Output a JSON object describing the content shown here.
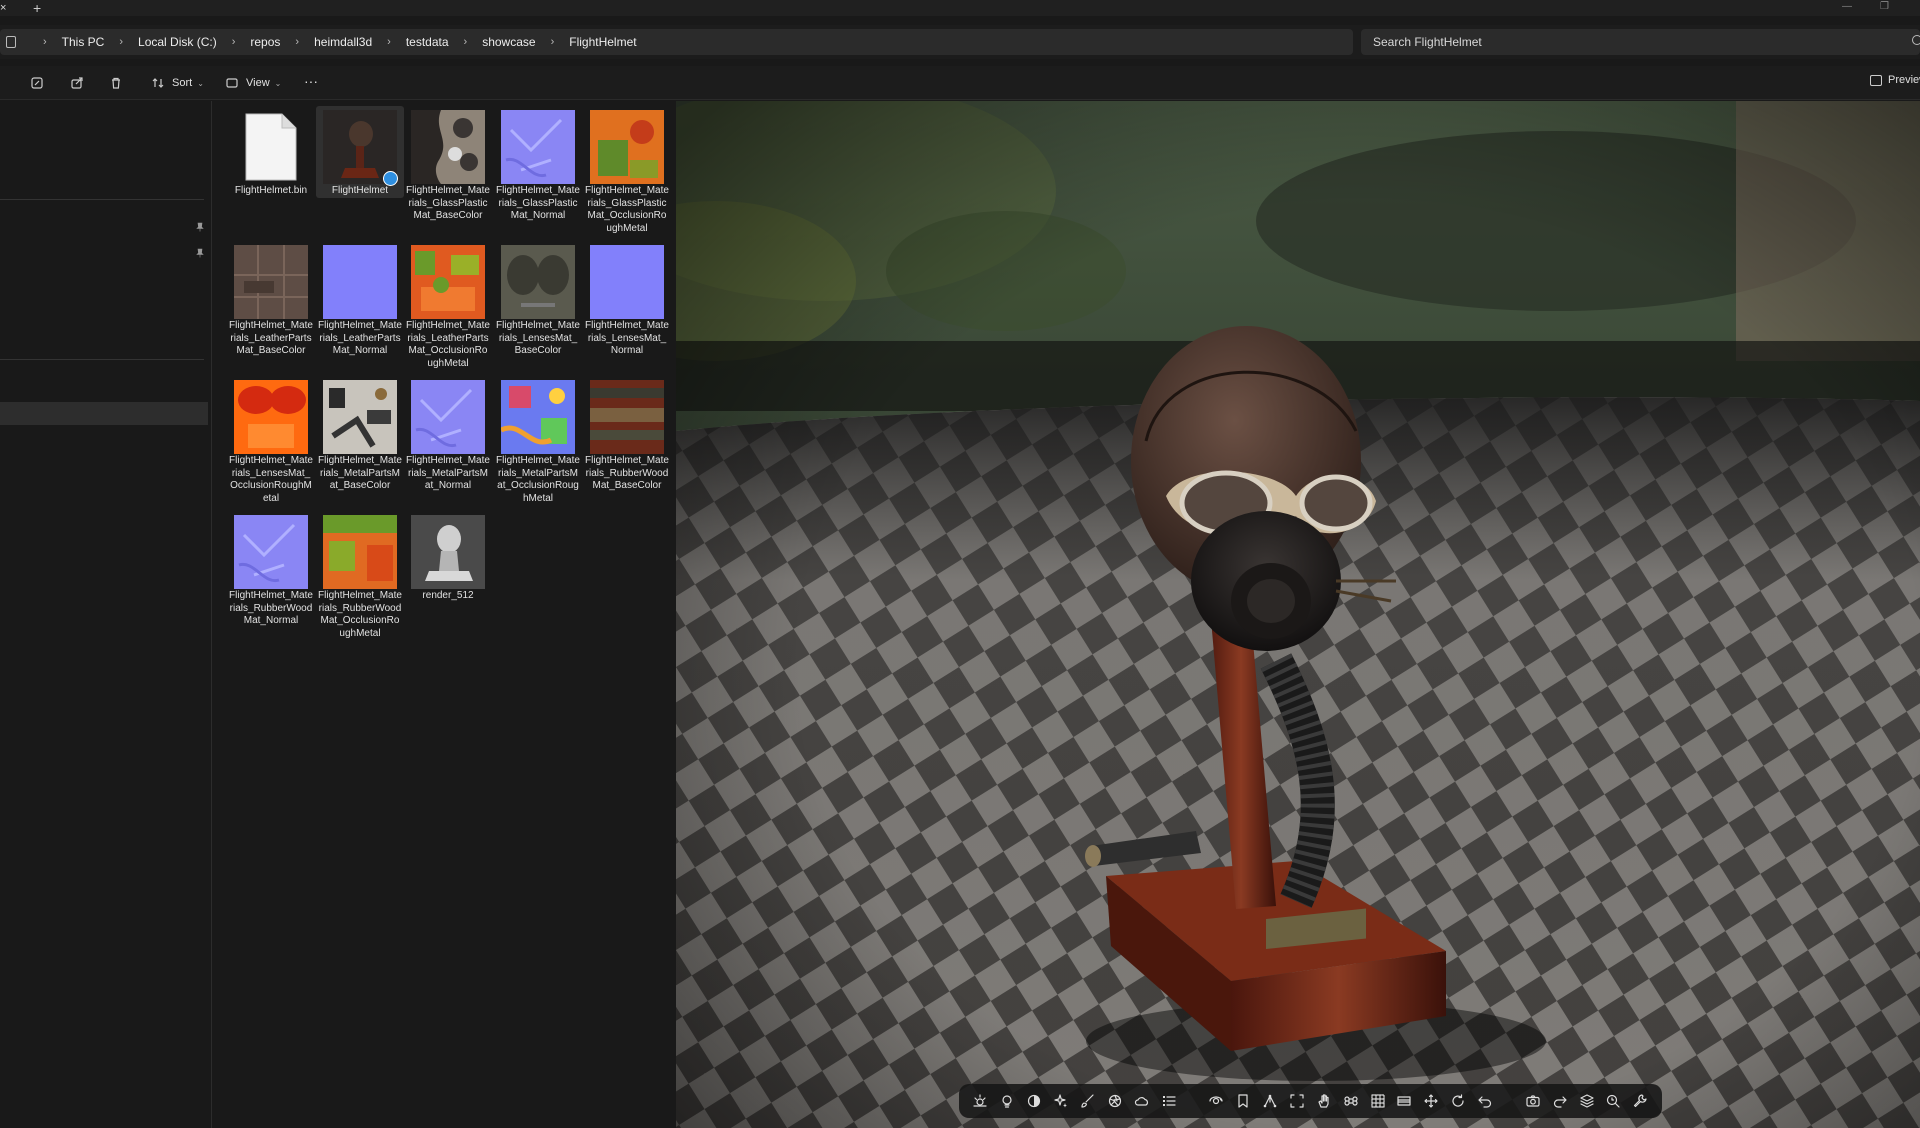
{
  "window": {
    "close_glyph": "×",
    "new_tab_glyph": "+",
    "minimize_glyph": "—",
    "maximize_glyph": "❐"
  },
  "breadcrumb": [
    "This PC",
    "Local Disk (C:)",
    "repos",
    "heimdall3d",
    "testdata",
    "showcase",
    "FlightHelmet"
  ],
  "search": {
    "placeholder": "Search FlightHelmet"
  },
  "command_bar": {
    "sort_label": "Sort",
    "view_label": "View",
    "more_label": "···",
    "preview_label": "Preview"
  },
  "files": [
    {
      "name": "FlightHelmet.bin",
      "thumb": "doc"
    },
    {
      "name": "FlightHelmet",
      "thumb": "helmet",
      "selected": true
    },
    {
      "name": "FlightHelmet_Materials_GlassPlasticMat_BaseColor",
      "thumb": "glassbase"
    },
    {
      "name": "FlightHelmet_Materials_GlassPlasticMat_Normal",
      "thumb": "normal"
    },
    {
      "name": "FlightHelmet_Materials_GlassPlasticMat_OcclusionRoughMetal",
      "thumb": "orm_orange"
    },
    {
      "name": "FlightHelmet_Materials_LeatherPartsMat_BaseColor",
      "thumb": "leather"
    },
    {
      "name": "FlightHelmet_Materials_LeatherPartsMat_Normal",
      "thumb": "normal_flat"
    },
    {
      "name": "FlightHelmet_Materials_LeatherPartsMat_OcclusionRoughMetal",
      "thumb": "orm_green"
    },
    {
      "name": "FlightHelmet_Materials_LensesMat_BaseColor",
      "thumb": "lensbase"
    },
    {
      "name": "FlightHelmet_Materials_LensesMat_Normal",
      "thumb": "normal_flat"
    },
    {
      "name": "FlightHelmet_Materials_LensesMat_OcclusionRoughMetal",
      "thumb": "lensorm"
    },
    {
      "name": "FlightHelmet_Materials_MetalPartsMat_BaseColor",
      "thumb": "metalbase"
    },
    {
      "name": "FlightHelmet_Materials_MetalPartsMat_Normal",
      "thumb": "normal"
    },
    {
      "name": "FlightHelmet_Materials_MetalPartsMat_OcclusionRoughMetal",
      "thumb": "metalorm"
    },
    {
      "name": "FlightHelmet_Materials_RubberWoodMat_BaseColor",
      "thumb": "woodbase"
    },
    {
      "name": "FlightHelmet_Materials_RubberWoodMat_Normal",
      "thumb": "normal"
    },
    {
      "name": "FlightHelmet_Materials_RubberWoodMat_OcclusionRoughMetal",
      "thumb": "orm_green2"
    },
    {
      "name": "render_512",
      "thumb": "bust"
    }
  ],
  "viewer_toolbar": {
    "icons": [
      "environment-icon",
      "light-icon",
      "contrast-icon",
      "sparkle-icon",
      "brush-icon",
      "aperture-icon",
      "cloud-icon",
      "list-icon",
      "camera-orbit-icon",
      "bookmark-icon",
      "skeleton-icon",
      "frame-icon",
      "hand-icon",
      "command-icon",
      "grid-icon",
      "film-icon",
      "move-icon",
      "refresh-icon",
      "undo-icon",
      "screenshot-icon",
      "redo-icon",
      "layers-icon",
      "inspect-icon",
      "wrench-icon"
    ]
  },
  "colors": {
    "accent": "#2f8fe0",
    "background": "#191919",
    "panel": "#2b2b2b"
  }
}
